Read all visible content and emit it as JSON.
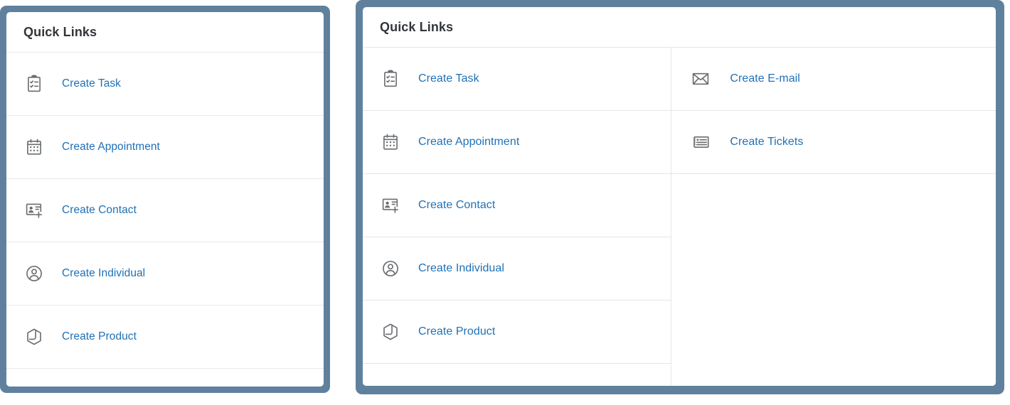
{
  "theme": {
    "frame_color": "#5f819d",
    "card_bg": "#ffffff",
    "link_color": "#2071b5",
    "title_color": "#32363a",
    "divider_color": "#e8e8e8",
    "icon_color": "#6a6d70"
  },
  "panels": [
    {
      "id": "left-panel",
      "title": "Quick Links",
      "columns": [
        {
          "id": "left-column-1",
          "items": [
            {
              "label": "Create Task",
              "icon": "clipboard-checklist-icon"
            },
            {
              "label": "Create Appointment",
              "icon": "calendar-icon"
            },
            {
              "label": "Create Contact",
              "icon": "contact-card-add-icon"
            },
            {
              "label": "Create Individual",
              "icon": "person-circle-icon"
            },
            {
              "label": "Create Product",
              "icon": "product-hexagon-icon"
            }
          ]
        }
      ]
    },
    {
      "id": "right-panel",
      "title": "Quick Links",
      "columns": [
        {
          "id": "right-column-1",
          "items": [
            {
              "label": "Create Task",
              "icon": "clipboard-checklist-icon"
            },
            {
              "label": "Create Appointment",
              "icon": "calendar-icon"
            },
            {
              "label": "Create Contact",
              "icon": "contact-card-add-icon"
            },
            {
              "label": "Create Individual",
              "icon": "person-circle-icon"
            },
            {
              "label": "Create Product",
              "icon": "product-hexagon-icon"
            }
          ]
        },
        {
          "id": "right-column-2",
          "items": [
            {
              "label": "Create E-mail",
              "icon": "envelope-icon"
            },
            {
              "label": "Create Tickets",
              "icon": "ticket-icon"
            }
          ]
        }
      ]
    }
  ]
}
